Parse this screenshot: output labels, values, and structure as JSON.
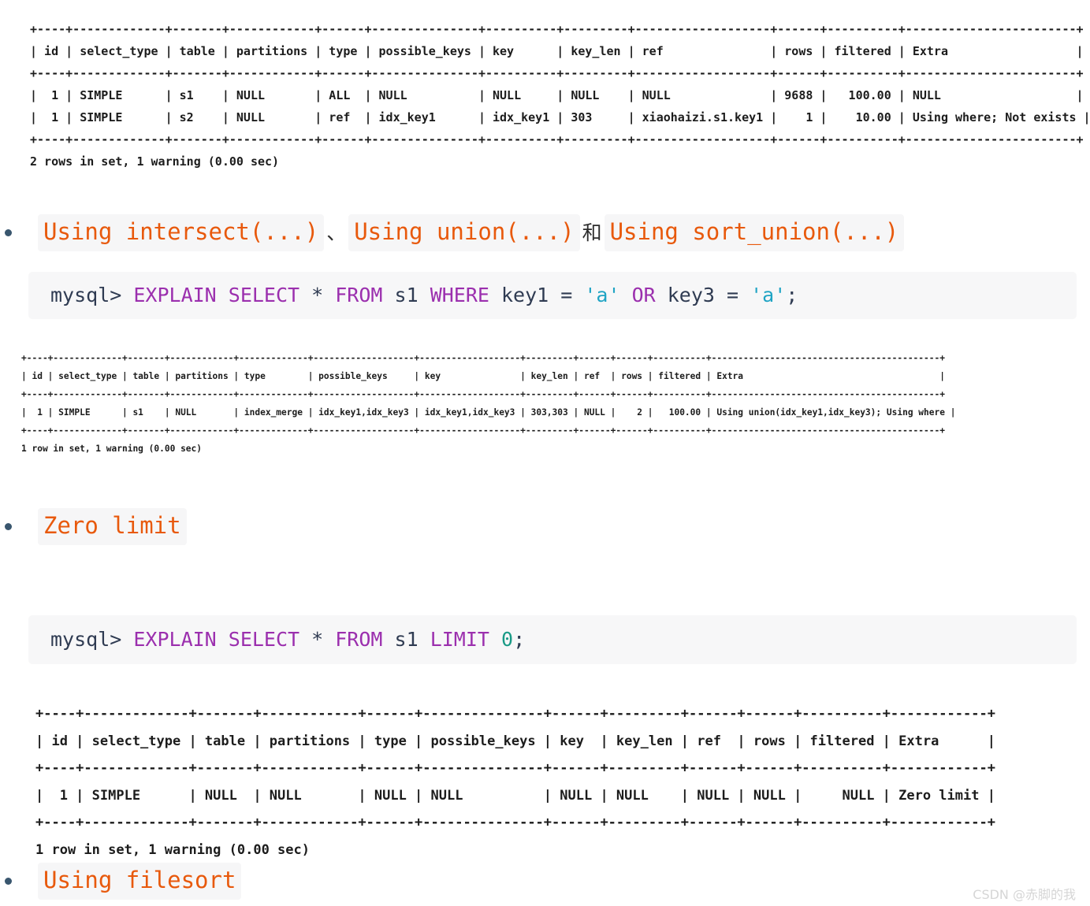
{
  "terminal_output_1": "+----+-------------+-------+------------+------+---------------+----------+---------+-------------------+------+----------+------------------------+\n| id | select_type | table | partitions | type | possible_keys | key      | key_len | ref               | rows | filtered | Extra                  |\n+----+-------------+-------+------------+------+---------------+----------+---------+-------------------+------+----------+------------------------+\n|  1 | SIMPLE      | s1    | NULL       | ALL  | NULL          | NULL     | NULL    | NULL              | 9688 |   100.00 | NULL                   |\n|  1 | SIMPLE      | s2    | NULL       | ref  | idx_key1      | idx_key1 | 303     | xiaohaizi.s1.key1 |    1 |    10.00 | Using where; Not exists |\n+----+-------------+-------+------------+------+---------------+----------+---------+-------------------+------+----------+------------------------+\n2 rows in set, 1 warning (0.00 sec)",
  "terminal_output_2": "+----+-------------+-------+------------+-------------+-------------------+-------------------+---------+------+------+----------+-------------------------------------------+\n| id | select_type | table | partitions | type        | possible_keys     | key               | key_len | ref  | rows | filtered | Extra                                     |\n+----+-------------+-------+------------+-------------+-------------------+-------------------+---------+------+------+----------+-------------------------------------------+\n|  1 | SIMPLE      | s1    | NULL       | index_merge | idx_key1,idx_key3 | idx_key1,idx_key3 | 303,303 | NULL |    2 |   100.00 | Using union(idx_key1,idx_key3); Using where |\n+----+-------------+-------+------------+-------------+-------------------+-------------------+---------+------+------+----------+-------------------------------------------+\n1 row in set, 1 warning (0.00 sec)",
  "terminal_output_3": "+----+-------------+-------+------------+------+---------------+------+---------+------+------+----------+------------+\n| id | select_type | table | partitions | type | possible_keys | key  | key_len | ref  | rows | filtered | Extra      |\n+----+-------------+-------+------------+------+---------------+------+---------+------+------+----------+------------+\n|  1 | SIMPLE      | NULL  | NULL       | NULL | NULL          | NULL | NULL    | NULL | NULL |     NULL | Zero limit |\n+----+-------------+-------+------------+------+---------------+------+---------+------+------+----------+------------+\n1 row in set, 1 warning (0.00 sec)",
  "headings": {
    "intersect": {
      "code_1": "Using intersect(...)",
      "separator_1": "、",
      "code_2": "Using union(...)",
      "separator_2": "和",
      "code_3": "Using sort_union(...)"
    },
    "zero_limit": {
      "code_1": "Zero limit"
    },
    "filesort": {
      "code_1": "Using filesort"
    }
  },
  "code_union": {
    "prompt": "mysql> ",
    "kw_explain": "EXPLAIN",
    "sp1": " ",
    "kw_select": "SELECT",
    "star": " * ",
    "kw_from": "FROM",
    "table": " s1 ",
    "kw_where": "WHERE",
    "expr_a": " key1 = ",
    "str_a": "'a'",
    "kw_or": " OR",
    "expr_b": " key3 = ",
    "str_b": "'a'",
    "semi": ";"
  },
  "code_limit": {
    "prompt": "mysql> ",
    "kw_explain": "EXPLAIN",
    "sp1": " ",
    "kw_select": "SELECT",
    "star": " * ",
    "kw_from": "FROM",
    "table": " s1 ",
    "kw_limit": "LIMIT",
    "sp2": " ",
    "num_zero": "0",
    "semi": ";"
  },
  "watermark": "CSDN @赤脚的我",
  "colors": {
    "code_text": "#e8590c",
    "code_bg": "#f6f6f7",
    "bullet": "#39566e",
    "sql_keyword": "#9b2fae",
    "sql_string": "#1fa4c4",
    "sql_number": "#199a86",
    "terminal_text": "#1c1c1c",
    "watermark": "#d6d6d6"
  }
}
